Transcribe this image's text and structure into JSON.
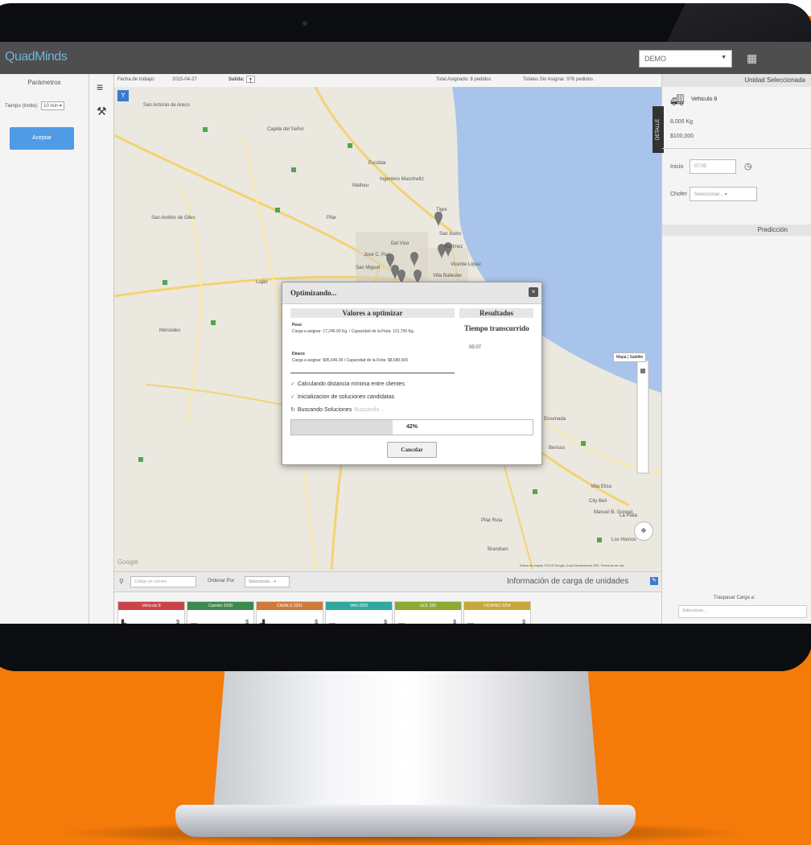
{
  "app": {
    "logo": "QuadMinds",
    "account_select": "DEMO",
    "grid_icon": "grid-icon"
  },
  "left_panel": {
    "title": "Parámetros",
    "tiempo_label": "Tiempo (límite):",
    "tiempo_value": "10 min",
    "accept_label": "Aceptar"
  },
  "info_bar": {
    "fecha_label": "Fecha de trabajo:",
    "fecha_value": "2015-04-27",
    "salida_label": "Salida:",
    "salida_value": "1",
    "total_asignado": "Total Asignado: 8 pedidos",
    "totales_sin_asignar": "Totales Sin Asignar: 976 pedidos"
  },
  "map": {
    "labels": [
      "San Antonio de Areco",
      "Capilla del Señor",
      "Escobar",
      "Ingeniero Maschwitz",
      "Matheu",
      "Tigre",
      "Pilar",
      "San Andrés de Giles",
      "San Isidro",
      "Martínez",
      "Vicente López",
      "Del Viso",
      "José C. Paz",
      "San Miguel",
      "Villa Ballester",
      "Luján",
      "Mercedes",
      "Ensenada",
      "Berisso",
      "La Plata",
      "Villa Elisa",
      "City Bell",
      "Manuel B. Gonnet",
      "Los Hornos",
      "Pilar Ruta",
      "Brandsen"
    ],
    "map_type": "Mapa",
    "satellite": "Satélite",
    "attribution": "Datos de mapas ©2015 Google, Inav/Geosistemas SRL   Términos de uso",
    "google": "Google"
  },
  "modal": {
    "title": "Optimizando...",
    "col_left": "Valores a optimizar",
    "col_right": "Resultados",
    "peso_label": "Peso",
    "peso_text": "Carga a asignar: 17,246.00 Kg. / Capacidad de la Flota: 121,750 Kg.",
    "dinero_label": "Dinero",
    "dinero_text": "Carga a asignar: $95,646.00 / Capacidad de la Flota: $8,680,000",
    "tiempo_title": "Tiempo transcurrido",
    "tiempo_value": "05:07",
    "steps": [
      {
        "label": "Calculando distancia mínima entre clientes",
        "state": "done"
      },
      {
        "label": "Inicializacion de soluciones candidatas",
        "state": "done"
      },
      {
        "label": "Buscando Soluciones",
        "state": "running",
        "extra": "Buscando..."
      }
    ],
    "progress": 42,
    "progress_label": "42%",
    "cancel_label": "Cancelar"
  },
  "bottom": {
    "search_placeholder": "Código de camión",
    "ordenar_label": "Ordenar Por:",
    "ordenar_value": "Seleccionar...",
    "carga_title": "Información de carga de unidades",
    "cards": [
      {
        "name": "Vehículo 8",
        "color": "#c9444a"
      },
      {
        "name": "Camión 2230",
        "color": "#3d8a4e"
      },
      {
        "name": "CAVALO 3251",
        "color": "#cf7a3a"
      },
      {
        "name": "VAN 3262",
        "color": "#2fa8a0"
      },
      {
        "name": "GOL 255",
        "color": "#8ea832"
      },
      {
        "name": "FIORINO 3254",
        "color": "#c6a73a"
      }
    ]
  },
  "right_panel": {
    "title": "Unidad Seleccionada",
    "vehicle": "Vehiculo 8",
    "weight": "8,000 Kg",
    "money": "$100,000",
    "tab": "DETALLE",
    "inicio_label": "Inicio",
    "inicio_value": "07:00",
    "chofer_label": "Chofer",
    "chofer_value": "Seleccionar...",
    "prediccion": "Predicción",
    "traspasar_label": "Traspasar Carga a:",
    "traspasar_value": "Seleccionar..."
  }
}
